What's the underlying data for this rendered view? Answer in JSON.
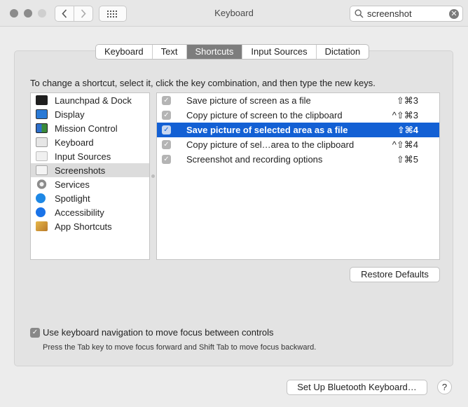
{
  "window": {
    "title": "Keyboard"
  },
  "search": {
    "value": "screenshot"
  },
  "tabs": [
    "Keyboard",
    "Text",
    "Shortcuts",
    "Input Sources",
    "Dictation"
  ],
  "active_tab": "Shortcuts",
  "instruction": "To change a shortcut, select it, click the key combination, and then type the new keys.",
  "categories": [
    {
      "label": "Launchpad & Dock",
      "icon": "launchpad-icon",
      "color": "#1f1f1f"
    },
    {
      "label": "Display",
      "icon": "display-icon",
      "color": "#2a7ad6"
    },
    {
      "label": "Mission Control",
      "icon": "mission-control-icon",
      "color": "#3a8a3a"
    },
    {
      "label": "Keyboard",
      "icon": "keyboard-icon",
      "color": "#9c9c9c"
    },
    {
      "label": "Input Sources",
      "icon": "input-sources-icon",
      "color": "#bdbdbd"
    },
    {
      "label": "Screenshots",
      "icon": "screenshots-icon",
      "color": "#a8a8a8"
    },
    {
      "label": "Services",
      "icon": "services-gear-icon",
      "color": "#8c8c8c"
    },
    {
      "label": "Spotlight",
      "icon": "spotlight-icon",
      "color": "#1e88e5"
    },
    {
      "label": "Accessibility",
      "icon": "accessibility-icon",
      "color": "#1a73e8"
    },
    {
      "label": "App Shortcuts",
      "icon": "app-shortcuts-icon",
      "color": "#d9a43a"
    }
  ],
  "selected_category": "Screenshots",
  "shortcuts": [
    {
      "label": "Save picture of screen as a file",
      "keys": "⇧⌘3",
      "checked": true
    },
    {
      "label": "Copy picture of screen to the clipboard",
      "keys": "^⇧⌘3",
      "checked": true
    },
    {
      "label": "Save picture of selected area as a file",
      "keys": "⇧⌘4",
      "checked": true
    },
    {
      "label": "Copy picture of sel…area to the clipboard",
      "keys": "^⇧⌘4",
      "checked": true
    },
    {
      "label": "Screenshot and recording options",
      "keys": "⇧⌘5",
      "checked": true
    }
  ],
  "selected_shortcut": "Save picture of selected area as a file",
  "restore_label": "Restore Defaults",
  "keyboard_nav": {
    "label": "Use keyboard navigation to move focus between controls",
    "hint": "Press the Tab key to move focus forward and Shift Tab to move focus backward.",
    "checked": true
  },
  "bluetooth_label": "Set Up Bluetooth Keyboard…",
  "help_label": "?",
  "colors": {
    "selection": "#1360d4",
    "active_tab": "#7d7d7d"
  }
}
